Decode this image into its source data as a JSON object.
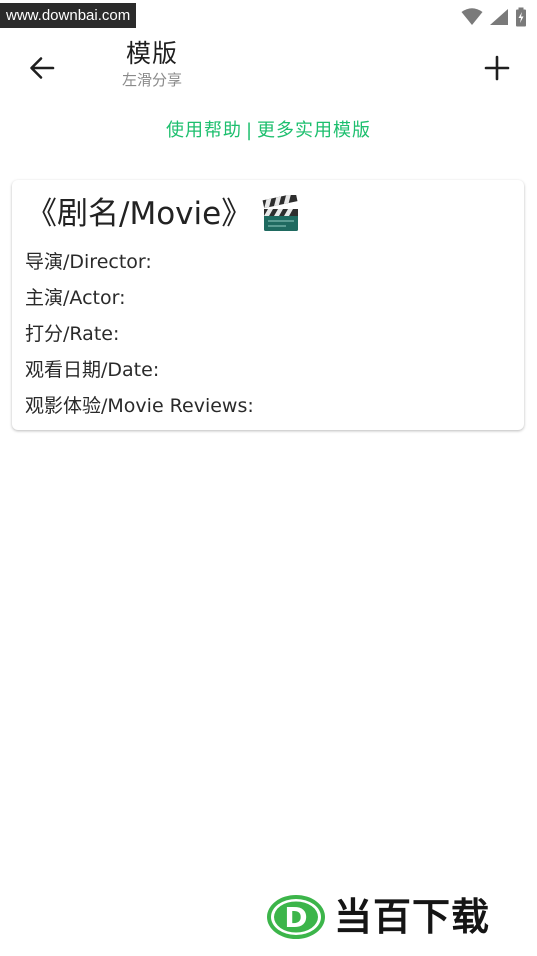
{
  "watermark_top": "www.downbai.com",
  "status_bar": {
    "icons": [
      "wifi-icon",
      "signal-icon",
      "battery-charging-icon"
    ]
  },
  "app_bar": {
    "back_icon": "arrow-left-icon",
    "title": "模版",
    "subtitle": "左滑分享",
    "add_icon": "plus-icon"
  },
  "help_link": {
    "left": "使用帮助",
    "separator": "|",
    "right": "更多实用模版"
  },
  "templates": [
    {
      "title": "《剧名/Movie》",
      "emoji_icon": "clapper-board-icon",
      "lines": [
        "导演/Director:",
        "主演/Actor:",
        "打分/Rate:",
        "观看日期/Date:",
        "观影体验/Movie Reviews:"
      ]
    }
  ],
  "bottom_watermark": {
    "badge_letter": "D",
    "text": "当百下载"
  },
  "colors": {
    "accent_green": "#1dbf6e",
    "logo_green": "#3cb54a",
    "text_dark": "#222222",
    "text_gray": "#8a8a8a"
  }
}
